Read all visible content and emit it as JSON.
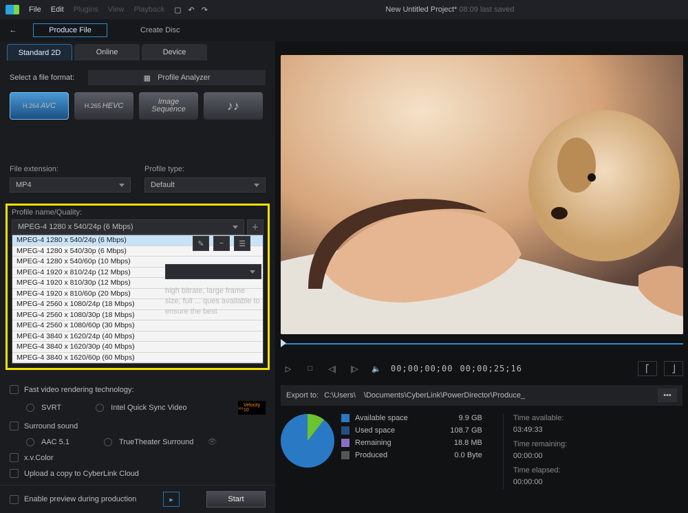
{
  "menubar": {
    "items": [
      "File",
      "Edit",
      "Plugins",
      "View",
      "Playback"
    ],
    "title": "New Untitled Project*",
    "saved": "08:09 last saved"
  },
  "produce": {
    "produce_label": "Produce File",
    "disc_label": "Create Disc"
  },
  "tabs": {
    "active": "Standard 2D",
    "items": [
      "Standard 2D",
      "Online",
      "Device"
    ]
  },
  "format": {
    "select_label": "Select a file format:",
    "analyzer": "Profile Analyzer",
    "buttons": [
      {
        "pre": "H.264",
        "main": "AVC"
      },
      {
        "pre": "H.265",
        "main": "HEVC"
      },
      {
        "pre": "Image",
        "main": "Sequence"
      },
      {
        "pre": "",
        "main": "♪♪"
      }
    ]
  },
  "extension": {
    "lbl": "File extension:",
    "value": "MP4"
  },
  "profile_type": {
    "lbl": "Profile type:",
    "value": "Default"
  },
  "quality": {
    "lbl": "Profile name/Quality:",
    "selected": "MPEG-4 1280 x 540/24p (6 Mbps)",
    "options": [
      "MPEG-4 1280 x 540/24p (6 Mbps)",
      "MPEG-4 1280 x 540/30p (6 Mbps)",
      "MPEG-4 1280 x 540/60p (10 Mbps)",
      "MPEG-4 1920 x 810/24p (12 Mbps)",
      "MPEG-4 1920 x 810/30p (12 Mbps)",
      "MPEG-4 1920 x 810/60p (20 Mbps)",
      "MPEG-4 2560 x 1080/24p (18 Mbps)",
      "MPEG-4 2560 x 1080/30p (18 Mbps)",
      "MPEG-4 2560 x 1080/60p (30 Mbps)",
      "MPEG-4 3840 x 1620/24p (40 Mbps)",
      "MPEG-4 3840 x 1620/30p (40 Mbps)",
      "MPEG-4 3840 x 1620/60p (60 Mbps)"
    ]
  },
  "desc": {
    "text": "high bitrate, large frame size, full ... ques available to ensure the best"
  },
  "opts": {
    "fast": "Fast video rendering technology:",
    "svrt": "SVRT",
    "qs": "Intel Quick Sync Video",
    "surround": "Surround sound",
    "aac": "AAC 5.1",
    "tts": "TrueTheater Surround",
    "xv": "x.v.Color",
    "cloud": "Upload a copy to CyberLink Cloud",
    "preview": "Enable preview during production",
    "velocity": "Velocity 10"
  },
  "start": {
    "label": "Start"
  },
  "transport": {
    "tc1": "00;00;00;00",
    "tc2": "00;00;25;16"
  },
  "export": {
    "label": "Export to:",
    "p1": "C:\\Users\\",
    "p2": "\\Documents\\CyberLink\\PowerDirector\\Produce_"
  },
  "stats": {
    "legend": [
      {
        "c": "#2a79c4",
        "l": "Available space",
        "v": "9.9  GB"
      },
      {
        "c": "#234f84",
        "l": "Used space",
        "v": "108.7  GB"
      },
      {
        "c": "#8a70c4",
        "l": "Remaining",
        "v": "18.8  MB"
      },
      {
        "c": "#555",
        "l": "Produced",
        "v": "0.0  Byte"
      }
    ],
    "times": [
      {
        "l": "Time available:",
        "v": "03:49:33"
      },
      {
        "l": "Time remaining:",
        "v": "00:00:00"
      },
      {
        "l": "Time elapsed:",
        "v": "00:00:00"
      }
    ]
  }
}
